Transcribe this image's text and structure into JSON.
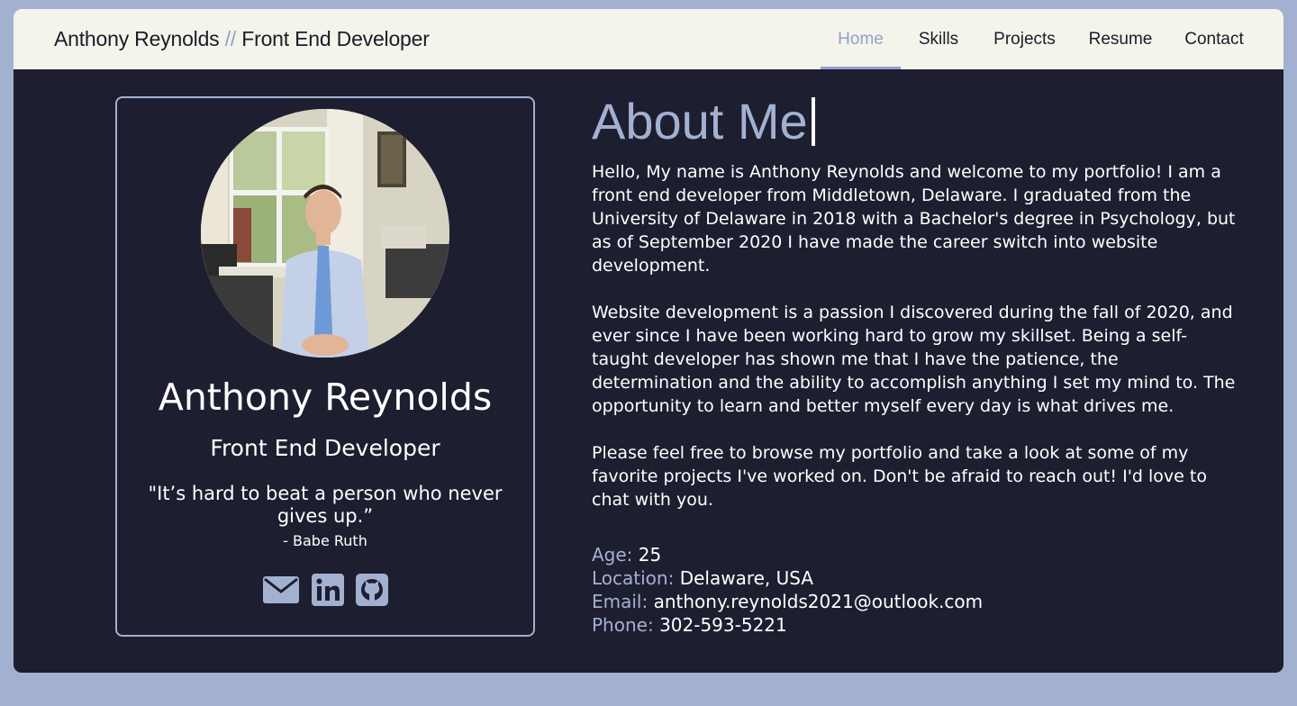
{
  "brand": {
    "name": "Anthony Reynolds",
    "separator": "//",
    "role": "Front End Developer"
  },
  "nav": {
    "items": [
      "Home",
      "Skills",
      "Projects",
      "Resume",
      "Contact"
    ],
    "active": "Home"
  },
  "profile": {
    "photo": "profile-photo",
    "name": "Anthony Reynolds",
    "title": "Front End Developer",
    "quote": "\"It’s hard to beat a person who never gives up.”",
    "quote_author": "- Babe Ruth",
    "social_icons": [
      "envelope-icon",
      "linkedin-icon",
      "github-icon"
    ]
  },
  "about": {
    "heading": "About Me",
    "paragraphs": [
      "Hello, My name is Anthony Reynolds and welcome to my portfolio! I am a front end developer from Middletown, Delaware. I graduated from the University of Delaware in 2018 with a Bachelor's degree in Psychology, but as of September 2020 I have made the career switch into website development.",
      "Website development is a passion I discovered during the fall of 2020, and ever since I have been working hard to grow my skillset. Being a self-taught developer has shown me that I have the patience, the determination and the ability to accomplish anything I set my mind to. The opportunity to learn and better myself every day is what drives me.",
      "Please feel free to browse my portfolio and take a look at some of my favorite projects I've worked on. Don't be afraid to reach out! I'd love to chat with you."
    ],
    "info": [
      {
        "label": "Age:",
        "value": "25"
      },
      {
        "label": "Location:",
        "value": "Delaware, USA"
      },
      {
        "label": "Email:",
        "value": "anthony.reynolds2021@outlook.com"
      },
      {
        "label": "Phone:",
        "value": "302-593-5221"
      }
    ]
  },
  "colors": {
    "page_bg": "#a3b1d1",
    "panel_bg": "#1e1e31",
    "navbar_bg": "#f5f4ea",
    "accent": "#8fa2cc",
    "text_light": "#ffffff",
    "text_dark": "#1b1b2b"
  }
}
